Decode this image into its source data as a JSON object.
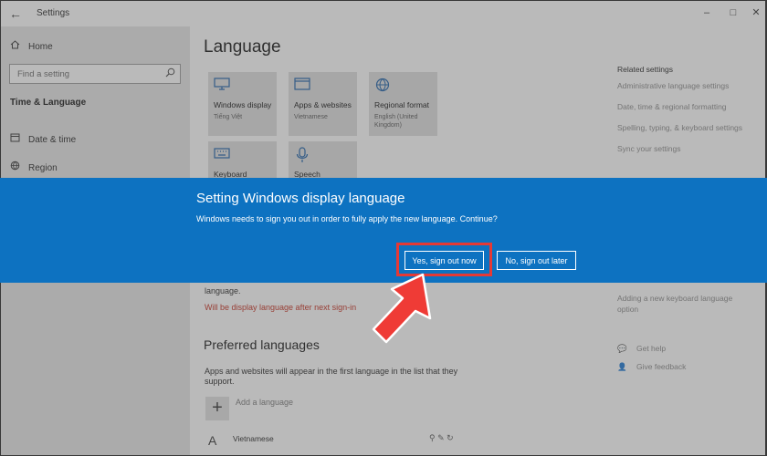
{
  "titlebar": {
    "back_glyph": "←",
    "title": "Settings",
    "min_glyph": "–",
    "max_glyph": "□",
    "close_glyph": "✕"
  },
  "sidebar": {
    "home_icon": "home-icon",
    "home_label": "Home",
    "search_placeholder": "Find a setting",
    "section": "Time & Language",
    "items": [
      {
        "icon": "calendar-icon",
        "label": "Date & time"
      },
      {
        "icon": "globe-icon",
        "label": "Region"
      }
    ]
  },
  "main": {
    "title": "Language",
    "tiles": [
      {
        "icon": "monitor-icon",
        "title": "Windows display",
        "sub": "Tiếng Việt"
      },
      {
        "icon": "window-icon",
        "title": "Apps & websites",
        "sub": "Vietnamese"
      },
      {
        "icon": "globe-icon",
        "title": "Regional format",
        "sub": "English (United Kingdom)"
      },
      {
        "icon": "keyboard-icon",
        "title": "Keyboard",
        "sub": ""
      },
      {
        "icon": "microphone-icon",
        "title": "Speech",
        "sub": ""
      }
    ],
    "bg_language_text": "language.",
    "red_note": "Will be display language after next sign-in",
    "preferred_heading": "Preferred languages",
    "preferred_desc_1": "Apps and websites will appear in the first language in the list that they",
    "preferred_desc_2": "support.",
    "add_language": "Add a language",
    "lang_vietnamese": "Vietnamese"
  },
  "related": {
    "heading": "Related settings",
    "links": [
      "Administrative language settings",
      "Date, time & regional formatting",
      "Spelling, typing, & keyboard settings",
      "Sync your settings"
    ],
    "lower_link_1": "Adding a new keyboard language",
    "lower_link_2": "option",
    "get_help": "Get help",
    "give_feedback": "Give feedback"
  },
  "dialog": {
    "title": "Setting Windows display language",
    "message": "Windows needs to sign you out in order to fully apply the new language. Continue?",
    "yes_label": "Yes, sign out now",
    "no_label": "No, sign out later"
  },
  "colors": {
    "banner": "#0d72c1",
    "highlight": "#e53935",
    "arrow": "#ef3b36",
    "note_red": "#c42b1c"
  }
}
